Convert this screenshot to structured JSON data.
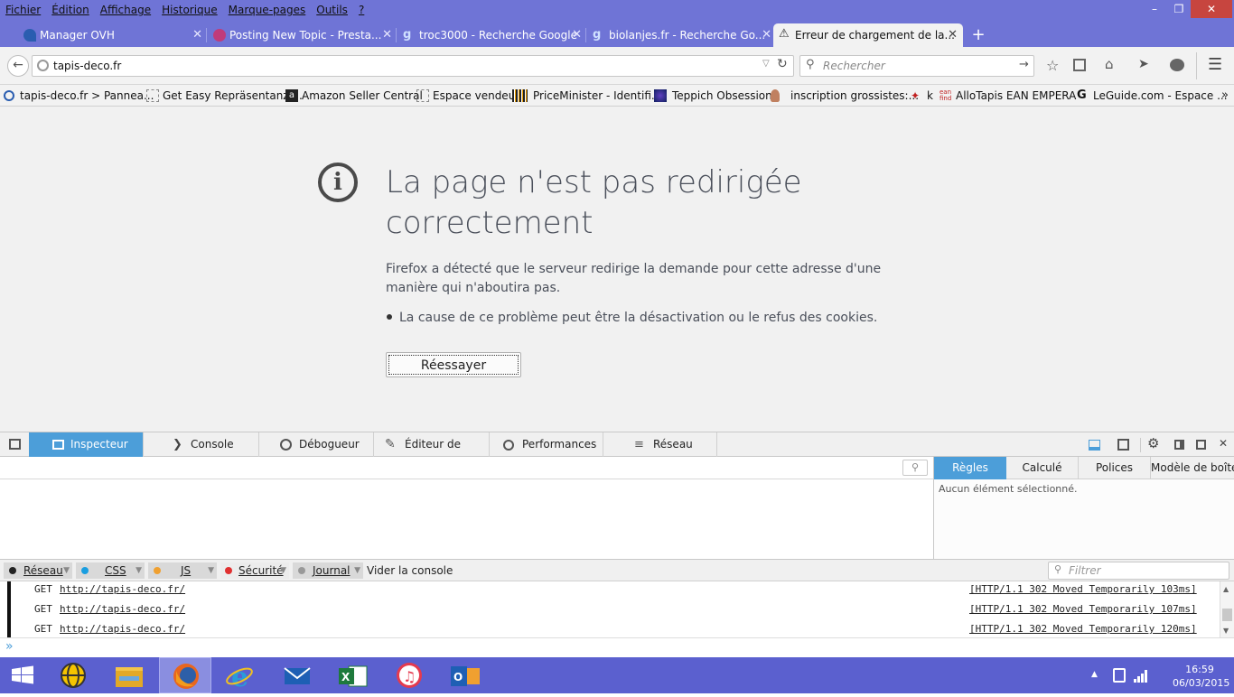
{
  "menu": [
    "Fichier",
    "Édition",
    "Affichage",
    "Historique",
    "Marque-pages",
    "Outils",
    "?"
  ],
  "window_controls": [
    "–",
    "❐",
    "✕"
  ],
  "tabs": [
    {
      "label": "Manager OVH",
      "icon": "ovh-icon",
      "color": "#2a5db0"
    },
    {
      "label": "Posting New Topic - Presta...",
      "icon": "prestashop-icon",
      "color": "#c03b7a"
    },
    {
      "label": "troc3000 - Recherche Google",
      "icon": "google-icon",
      "color": "#4f86f7"
    },
    {
      "label": "biolanjes.fr - Recherche Go...",
      "icon": "google-icon",
      "color": "#4f86f7"
    },
    {
      "label": "Erreur de chargement de la...",
      "icon": "warning-icon",
      "color": "#f0c020"
    }
  ],
  "new_tab_label": "+",
  "url": "tapis-deco.fr",
  "search_placeholder": "Rechercher",
  "bookmarks": [
    {
      "label": "tapis-deco.fr > Pannea...",
      "icon": "site-icon"
    },
    {
      "label": "Get Easy Repräsentanz ...",
      "icon": "page-icon"
    },
    {
      "label": "Amazon Seller Central",
      "icon": "amazon-icon"
    },
    {
      "label": "Espace vendeur",
      "icon": "page-icon"
    },
    {
      "label": "PriceMinister - Identifi...",
      "icon": "priceminister-icon"
    },
    {
      "label": "Teppich Obsession",
      "icon": "teppich-icon"
    },
    {
      "label": "inscription grossistes:...",
      "icon": "user-icon"
    },
    {
      "label": "k",
      "icon": "pin-icon"
    },
    {
      "label": "AlloTapis EAN EMPERA",
      "icon": "ean-icon"
    },
    {
      "label": "LeGuide.com - Espace ...",
      "icon": "leguide-icon"
    }
  ],
  "bookmarks_overflow": "»",
  "error": {
    "title_line1": "La page n'est pas redirigée",
    "title_line2": "correctement",
    "description_line1": "Firefox a détecté que le serveur redirige la demande pour cette adresse d'une",
    "description_line2": "manière qui n'aboutira pas.",
    "bullet": "La cause de ce problème peut être la désactivation ou le refus des cookies.",
    "retry_button": "Réessayer"
  },
  "devtools": {
    "tabs": [
      "Inspecteur",
      "Console",
      "Débogueur",
      "Éditeur de style",
      "Performances",
      "Réseau"
    ],
    "active_tab": "Inspecteur",
    "side_tabs": [
      "Règles",
      "Calculé",
      "Polices",
      "Modèle de boîte"
    ],
    "no_selection": "Aucun élément sélectionné.",
    "console_filters": [
      {
        "label": "Réseau",
        "color": "#222222"
      },
      {
        "label": "CSS",
        "color": "#1a9ee0"
      },
      {
        "label": "JS",
        "color": "#f0a030"
      },
      {
        "label": "Sécurité",
        "color": "#e03030"
      },
      {
        "label": "Journal",
        "color": "#999999"
      }
    ],
    "clear_console": "Vider la console",
    "filter_placeholder": "Filtrer",
    "log": [
      {
        "method": "GET",
        "url": "http://tapis-deco.fr/",
        "status": "[HTTP/1.1 302 Moved Temporarily 103ms]"
      },
      {
        "method": "GET",
        "url": "http://tapis-deco.fr/",
        "status": "[HTTP/1.1 302 Moved Temporarily 107ms]"
      },
      {
        "method": "GET",
        "url": "http://tapis-deco.fr/",
        "status": "[HTTP/1.1 302 Moved Temporarily 120ms]"
      }
    ],
    "prompt": "»"
  },
  "taskbar": {
    "apps": [
      "start-icon",
      "network-globe-icon",
      "file-explorer-icon",
      "firefox-icon",
      "internet-explorer-icon",
      "mail-icon",
      "excel-icon",
      "itunes-icon",
      "outlook-icon"
    ],
    "active_app": "firefox-icon",
    "time": "16:59",
    "date": "06/03/2015"
  },
  "colors": {
    "titlebar": "#6f74d6",
    "taskbar": "#5b60cf",
    "devtools_active": "#4c9ed9"
  }
}
